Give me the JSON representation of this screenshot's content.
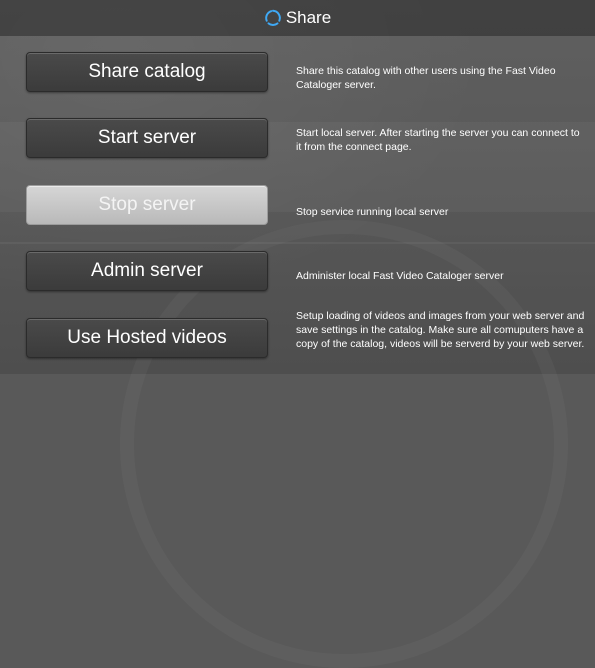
{
  "header": {
    "title": "Share",
    "logo_icon": "share-logo-icon"
  },
  "actions": [
    {
      "button": "Share catalog",
      "description": "Share this catalog with other users using the Fast Video Cataloger server."
    },
    {
      "button": "Start server",
      "description": "Start local server. After starting the server you can connect to it from the connect page."
    },
    {
      "button": "Stop server",
      "description": "Stop service running local server",
      "state": "disabled"
    },
    {
      "button": "Admin server",
      "description": "Administer local Fast Video Cataloger server"
    },
    {
      "button": "Use Hosted videos",
      "description": "Setup loading of videos and images from your web server and save settings in the catalog. Make sure all comuputers have a copy of the catalog, videos will be serverd by your web server."
    }
  ],
  "colors": {
    "accent": "#3fa9f5",
    "background": "#595959",
    "button": "#404040",
    "button_disabled": "#c8c8c8"
  }
}
